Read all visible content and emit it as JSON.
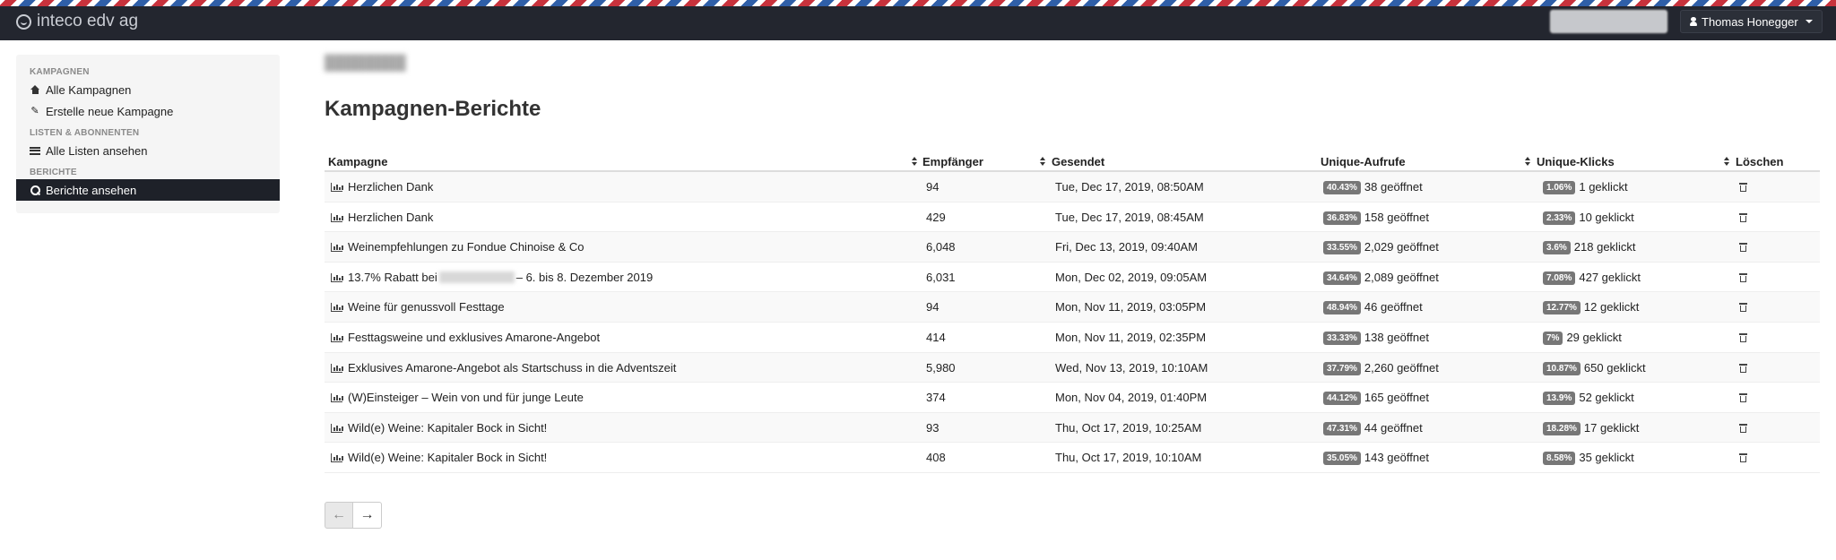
{
  "brand": {
    "name": "inteco edv ag"
  },
  "user": {
    "name": "Thomas Honegger"
  },
  "sidebar": {
    "sections": [
      {
        "title": "KAMPAGNEN",
        "items": [
          {
            "label": "Alle Kampagnen",
            "icon": "home-icon"
          },
          {
            "label": "Erstelle neue Kampagne",
            "icon": "edit-icon"
          }
        ]
      },
      {
        "title": "LISTEN & ABONNENTEN",
        "items": [
          {
            "label": "Alle Listen ansehen",
            "icon": "list-icon"
          }
        ]
      },
      {
        "title": "BERICHTE",
        "items": [
          {
            "label": "Berichte ansehen",
            "icon": "search-icon",
            "active": true
          }
        ]
      }
    ]
  },
  "page": {
    "title": "Kampagnen-Berichte"
  },
  "table": {
    "headers": {
      "campaign": "Kampagne",
      "recipients": "Empfänger",
      "sent": "Gesendet",
      "opens": "Unique-Aufrufe",
      "clicks": "Unique-Klicks",
      "delete": "Löschen"
    },
    "rows": [
      {
        "campaign": "Herzlichen Dank",
        "recipients": "94",
        "sent": "Tue, Dec 17, 2019, 08:50AM",
        "opens_pct": "40.43%",
        "opens": "38 geöffnet",
        "clicks_pct": "1.06%",
        "clicks": "1 geklickt"
      },
      {
        "campaign": "Herzlichen Dank",
        "recipients": "429",
        "sent": "Tue, Dec 17, 2019, 08:45AM",
        "opens_pct": "36.83%",
        "opens": "158 geöffnet",
        "clicks_pct": "2.33%",
        "clicks": "10 geklickt"
      },
      {
        "campaign": "Weinempfehlungen zu Fondue Chinoise & Co",
        "recipients": "6,048",
        "sent": "Fri, Dec 13, 2019, 09:40AM",
        "opens_pct": "33.55%",
        "opens": "2,029 geöffnet",
        "clicks_pct": "3.6%",
        "clicks": "218 geklickt"
      },
      {
        "campaign": "13.7% Rabatt bei",
        "campaign_suffix": "– 6. bis 8. Dezember 2019",
        "recipients": "6,031",
        "sent": "Mon, Dec 02, 2019, 09:05AM",
        "opens_pct": "34.64%",
        "opens": "2,089 geöffnet",
        "clicks_pct": "7.08%",
        "clicks": "427 geklickt"
      },
      {
        "campaign": "Weine für genussvoll Festtage",
        "recipients": "94",
        "sent": "Mon, Nov 11, 2019, 03:05PM",
        "opens_pct": "48.94%",
        "opens": "46 geöffnet",
        "clicks_pct": "12.77%",
        "clicks": "12 geklickt"
      },
      {
        "campaign": "Festtagsweine und exklusives Amarone-Angebot",
        "recipients": "414",
        "sent": "Mon, Nov 11, 2019, 02:35PM",
        "opens_pct": "33.33%",
        "opens": "138 geöffnet",
        "clicks_pct": "7%",
        "clicks": "29 geklickt"
      },
      {
        "campaign": "Exklusives Amarone-Angebot als Startschuss in die Adventszeit",
        "recipients": "5,980",
        "sent": "Wed, Nov 13, 2019, 10:10AM",
        "opens_pct": "37.79%",
        "opens": "2,260 geöffnet",
        "clicks_pct": "10.87%",
        "clicks": "650 geklickt"
      },
      {
        "campaign": "(W)Einsteiger – Wein von und für junge Leute",
        "recipients": "374",
        "sent": "Mon, Nov 04, 2019, 01:40PM",
        "opens_pct": "44.12%",
        "opens": "165 geöffnet",
        "clicks_pct": "13.9%",
        "clicks": "52 geklickt"
      },
      {
        "campaign": "Wild(e) Weine: Kapitaler Bock in Sicht!",
        "recipients": "93",
        "sent": "Thu, Oct 17, 2019, 10:25AM",
        "opens_pct": "47.31%",
        "opens": "44 geöffnet",
        "clicks_pct": "18.28%",
        "clicks": "17 geklickt"
      },
      {
        "campaign": "Wild(e) Weine: Kapitaler Bock in Sicht!",
        "recipients": "408",
        "sent": "Thu, Oct 17, 2019, 10:10AM",
        "opens_pct": "35.05%",
        "opens": "143 geöffnet",
        "clicks_pct": "8.58%",
        "clicks": "35 geklickt"
      }
    ]
  },
  "pager": {
    "prev": "←",
    "next": "→"
  }
}
